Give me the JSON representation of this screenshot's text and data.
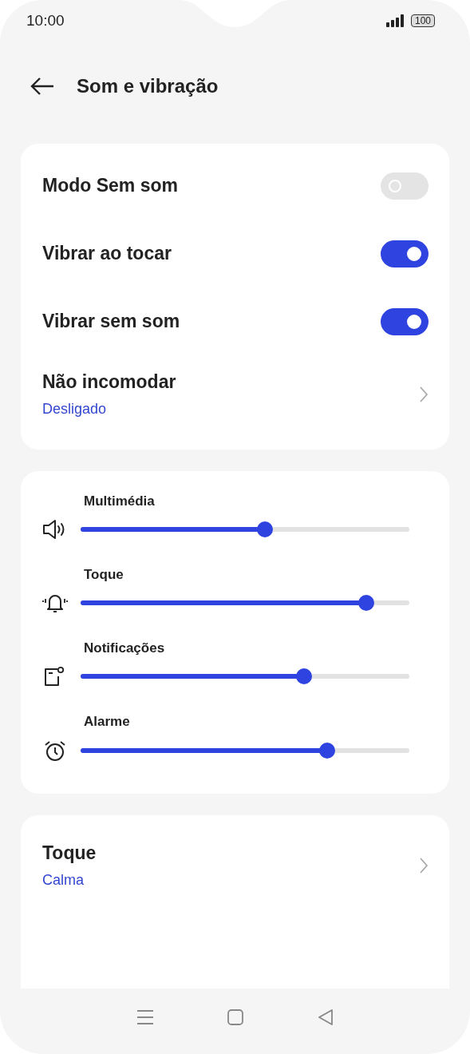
{
  "status_bar": {
    "time": "10:00",
    "battery": "100"
  },
  "header": {
    "title": "Som e vibração"
  },
  "toggles": [
    {
      "label": "Modo Sem som",
      "on": false
    },
    {
      "label": "Vibrar ao tocar",
      "on": true
    },
    {
      "label": "Vibrar sem som",
      "on": true
    }
  ],
  "dnd": {
    "label": "Não incomodar",
    "value": "Desligado"
  },
  "volumes": [
    {
      "label": "Multimédia",
      "kind": "media",
      "level": 0.56
    },
    {
      "label": "Toque",
      "kind": "ring",
      "level": 0.87
    },
    {
      "label": "Notificações",
      "kind": "notification",
      "level": 0.68
    },
    {
      "label": "Alarme",
      "kind": "alarm",
      "level": 0.75
    }
  ],
  "ringtone": {
    "label": "Toque",
    "value": "Calma"
  }
}
